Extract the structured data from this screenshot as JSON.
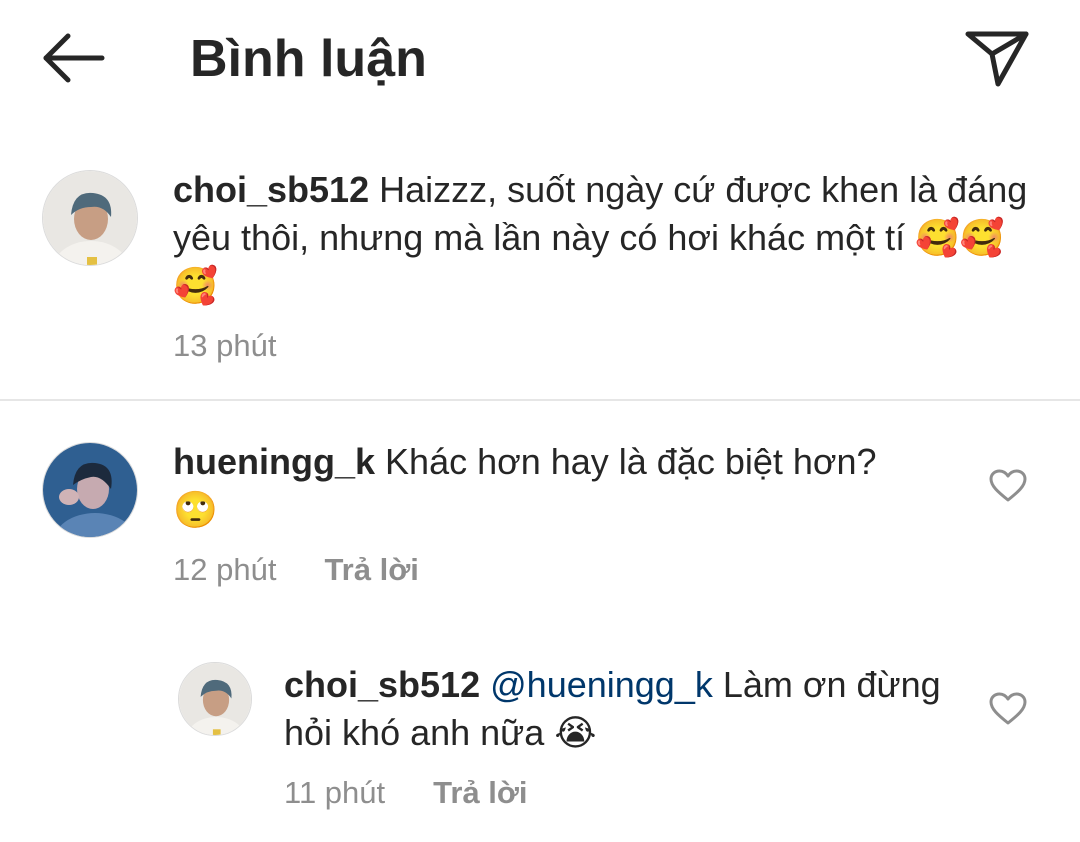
{
  "header": {
    "title": "Bình luận",
    "back_icon": "arrow-left-icon",
    "send_icon": "paper-plane-icon"
  },
  "comments": [
    {
      "username": "choi_sb512",
      "text": "Haizzz, suốt ngày cứ được khen là đáng yêu thôi, nhưng mà lần này có hơi khác một tí",
      "emoji": "🥰🥰🥰",
      "time": "13 phút"
    },
    {
      "username": "hueningg_k",
      "text": "Khác hơn hay là đặc biệt hơn?",
      "emoji": "🙄",
      "time": "12 phút",
      "reply_label": "Trả lời",
      "like_icon": "heart-outline-icon"
    },
    {
      "username": "choi_sb512",
      "mention": "@hueningg_k",
      "text": "Làm ơn đừng hỏi khó anh nữa",
      "emoji": "😭",
      "time": "11 phút",
      "reply_label": "Trả lời",
      "like_icon": "heart-outline-icon"
    }
  ],
  "colors": {
    "text": "#262626",
    "secondary": "#8e8e8e",
    "mention": "#00376b",
    "divider": "#e6e6e6"
  }
}
